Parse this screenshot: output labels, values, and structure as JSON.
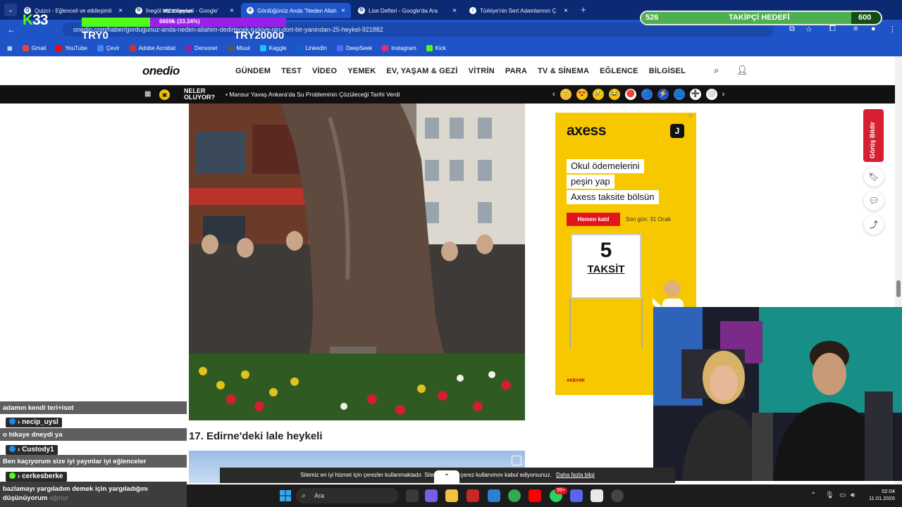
{
  "tabs": [
    {
      "title": "Quizci - Eğlenceli ve etkileşimli",
      "fav": "Q",
      "active": false
    },
    {
      "title": "İnegöl köfte heykeli - Google'",
      "fav": "G",
      "active": false
    },
    {
      "title": "Gördüğünüz Anda \"Neden Allah",
      "fav": "o",
      "active": true
    },
    {
      "title": "Lise Defteri - Google'da Ara",
      "fav": "G",
      "active": false
    },
    {
      "title": "Türkiye'nin Sert Adamlarının Ç",
      "fav": "♪",
      "active": false
    }
  ],
  "address": {
    "url": "onedio.com/haber/gordugunuz-anda-neden-allahim-dedirtecek-turkiye-nin-dort-bir-yanindan-25-heykel-921882"
  },
  "bookmarks": [
    {
      "label": "Gmail",
      "color": "#ea4335"
    },
    {
      "label": "YouTube",
      "color": "#ff0000"
    },
    {
      "label": "Çevir",
      "color": "#4285f4"
    },
    {
      "label": "Adobe Acrobat",
      "color": "#d32f2f"
    },
    {
      "label": "Dersonet",
      "color": "#8e24aa"
    },
    {
      "label": "Miuul",
      "color": "#555555"
    },
    {
      "label": "Kaggle",
      "color": "#20beff"
    },
    {
      "label": "LinkedIn",
      "color": "#0a66c2"
    },
    {
      "label": "DeepSeek",
      "color": "#4d6bfe"
    },
    {
      "label": "Instagram",
      "color": "#e1306c"
    },
    {
      "label": "Kick",
      "color": "#53fc18"
    }
  ],
  "stream": {
    "channel_number": "33",
    "goal_label": "IRL Ekipman",
    "goal_progress_text": "6669₺ (33.34%)",
    "goal_progress": 0.3334,
    "goal_start": "TRY0",
    "goal_target": "TRY20000",
    "follower_current": "526",
    "follower_label": "TAKİPÇİ HEDEFİ",
    "follower_goal": "600",
    "follower_progress": 0.877
  },
  "site": {
    "logo": "onedio",
    "nav": [
      "GÜNDEM",
      "TEST",
      "VİDEO",
      "YEMEK",
      "EV, YAŞAM & GEZİ",
      "VİTRİN",
      "PARA",
      "TV & SİNEMA",
      "EĞLENCE",
      "BİLGİSEL"
    ],
    "neler_line1": "NELER",
    "neler_line2": "OLUYOR?",
    "news_ticker": "Mansur Yavaş Ankara'da Su Probleminin Çözüleceği Tarihi Verdi",
    "reaction_emojis": [
      "🙂",
      "😍",
      "😢",
      "😂",
      "🔴",
      "🔵",
      "⚡",
      "🟦",
      "➕",
      "⚪"
    ]
  },
  "article": {
    "heading": "17. Edirne'deki lale heykeli"
  },
  "ad": {
    "brand": "axess",
    "badge": "J",
    "lines": [
      "Okul ödemelerini",
      "peşin yap",
      "Axess taksite bölsün"
    ],
    "button": "Hemen katıl",
    "deadline": "Son gün: 31 Ocak",
    "board_number": "5",
    "board_word": "TAKSİT",
    "footer": "AKBANK",
    "tag": "▷"
  },
  "side": {
    "report_label": "Görüş Bildir"
  },
  "chat": {
    "messages": [
      {
        "text": "adamın kendi teri+isot"
      },
      {
        "text": "o hikaye dneydi ya"
      },
      {
        "text": "Ben kaçıyorum size iyi yayınlar iyi eğlenceler"
      }
    ],
    "users": [
      {
        "name": "necip_uysl",
        "color": "#f5c400"
      },
      {
        "name": "Custody1",
        "color": "#f5c400"
      },
      {
        "name": "cerkesberke",
        "color": "#53fc18"
      }
    ],
    "last_message": "bazlamayı yargıladım demek için yargıladığını düşünüyorum",
    "last_suffix": "ağmur"
  },
  "cookie": {
    "text": "Sitemiz en iyi hizmet için çerezler kullanmaktadır. Siteye girerek çerez kullanımını kabul ediyorsunuz.",
    "link": "Daha fazla bilgi"
  },
  "taskbar": {
    "search_placeholder": "Ara",
    "notification_count": "99+",
    "time": "02:04",
    "date": "11.01.2026"
  }
}
